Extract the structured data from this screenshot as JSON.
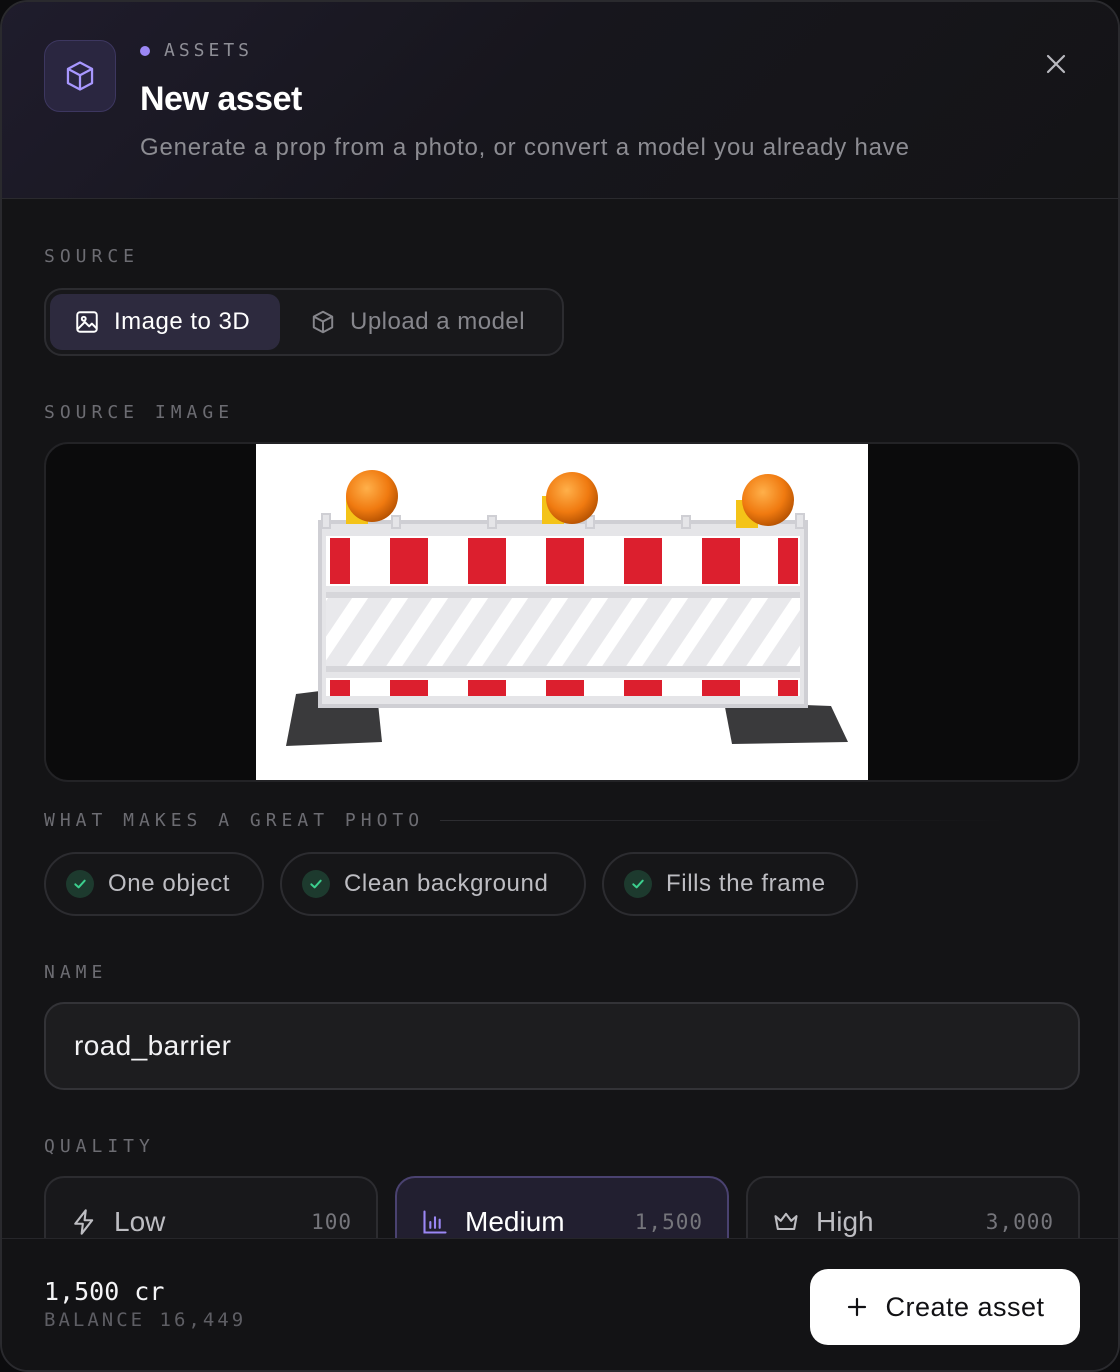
{
  "header": {
    "eyebrow": "ASSETS",
    "title": "New asset",
    "subtitle": "Generate a prop from a photo, or convert a model you already have",
    "icon": "cube-icon",
    "accent": "#9b87f5"
  },
  "source": {
    "label": "SOURCE",
    "options": [
      {
        "label": "Image to 3D",
        "icon": "image-icon",
        "selected": true
      },
      {
        "label": "Upload a model",
        "icon": "cube-icon",
        "selected": false
      }
    ]
  },
  "source_image": {
    "label": "SOURCE IMAGE",
    "subject": "road barrier with warning lamps"
  },
  "tips": {
    "label": "WHAT MAKES A GREAT PHOTO",
    "items": [
      "One object",
      "Clean background",
      "Fills the frame"
    ],
    "check_color": "#3ccf8e"
  },
  "name": {
    "label": "NAME",
    "value": "road_barrier"
  },
  "quality": {
    "label": "QUALITY",
    "options": [
      {
        "label": "Low",
        "cost": "100",
        "icon": "bolt-icon",
        "selected": false
      },
      {
        "label": "Medium",
        "cost": "1,500",
        "icon": "bar-chart-icon",
        "selected": true
      },
      {
        "label": "High",
        "cost": "3,000",
        "icon": "crown-icon",
        "selected": false
      }
    ]
  },
  "footer": {
    "cost": "1,500 cr",
    "balance": "BALANCE 16,449",
    "create_label": "Create asset"
  }
}
